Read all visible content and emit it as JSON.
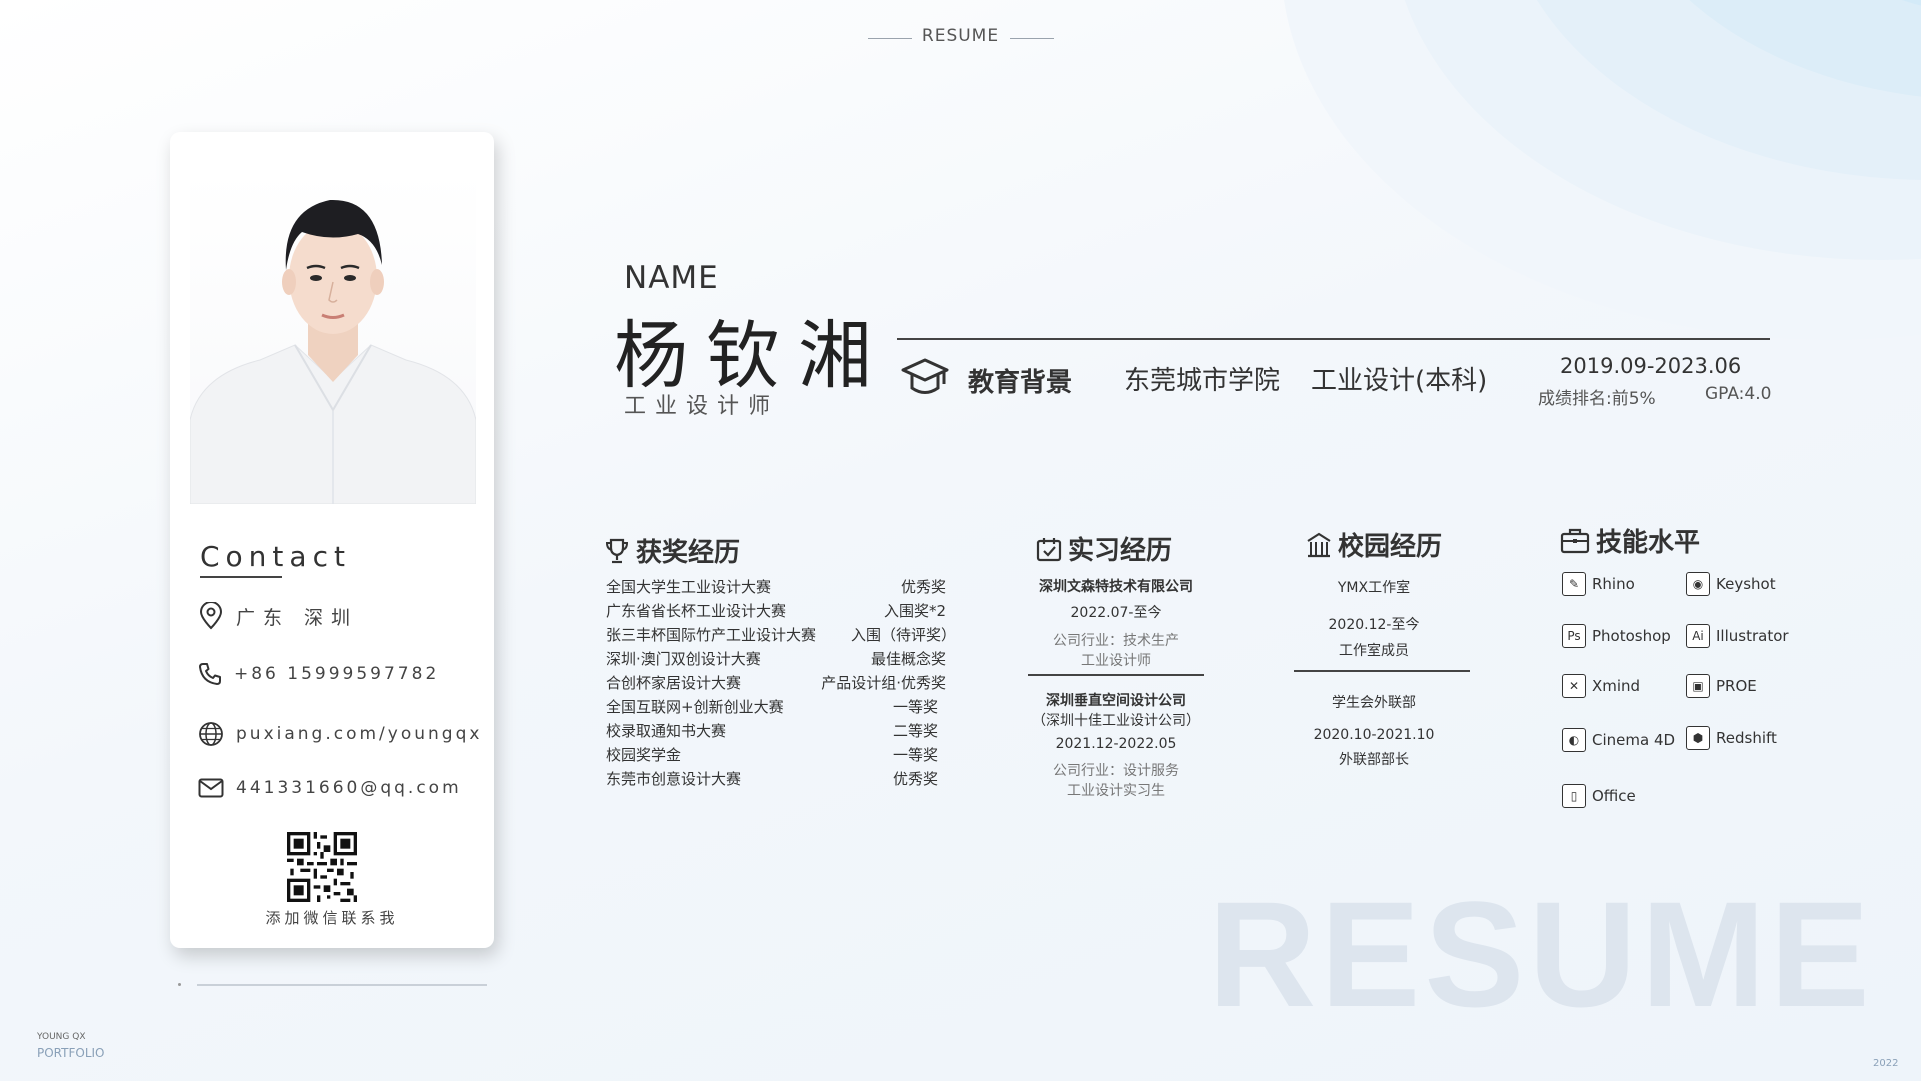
{
  "header": {
    "title": "RESUME"
  },
  "profile": {
    "name_label": "NAME",
    "name": "杨钦湘",
    "role": "工业设计师"
  },
  "contact": {
    "title": "Contact",
    "location": "广东 深圳",
    "phone": "+86 15999597782",
    "website": "puxiang.com/youngqx",
    "email": "441331660@qq.com",
    "qr_caption": "添加微信联系我"
  },
  "education": {
    "title": "教育背景",
    "school": "东莞城市学院",
    "major": "工业设计(本科)",
    "date": "2019.09-2023.06",
    "rank": "成绩排名:前5%",
    "gpa": "GPA:4.0"
  },
  "awards": {
    "title": "获奖经历",
    "items": [
      {
        "name": "全国大学生工业设计大赛",
        "result": "优秀奖"
      },
      {
        "name": "广东省省长杯工业设计大赛",
        "result": "入围奖*2"
      },
      {
        "name": "张三丰杯国际竹产工业设计大赛",
        "result": "入围（待评奖）"
      },
      {
        "name": "深圳·澳门双创设计大赛",
        "result": "最佳概念奖"
      },
      {
        "name": "合创杯家居设计大赛",
        "result": "产品设计组·优秀奖"
      },
      {
        "name": "全国互联网+创新创业大赛",
        "result": "一等奖"
      },
      {
        "name": "校录取通知书大赛",
        "result": "二等奖"
      },
      {
        "name": "校园奖学金",
        "result": "一等奖"
      },
      {
        "name": "东莞市创意设计大赛",
        "result": "优秀奖"
      }
    ]
  },
  "internship": {
    "title": "实习经历",
    "items": [
      {
        "company": "深圳文森特技术有限公司",
        "company2": "",
        "date": "2022.07-至今",
        "industry": "公司行业：技术生产",
        "position": "工业设计师"
      },
      {
        "company": "深圳垂直空间设计公司",
        "company2": "（深圳十佳工业设计公司）",
        "date": "2021.12-2022.05",
        "industry": "公司行业：设计服务",
        "position": "工业设计实习生"
      }
    ]
  },
  "campus": {
    "title": "校园经历",
    "items": [
      {
        "org": "YMX工作室",
        "date": "2020.12-至今",
        "role": "工作室成员"
      },
      {
        "org": "学生会外联部",
        "date": "2020.10-2021.10",
        "role": "外联部部长"
      }
    ]
  },
  "skills": {
    "title": "技能水平",
    "items": [
      {
        "name": "Rhino",
        "icon": "rhino-icon",
        "glyph": "✎"
      },
      {
        "name": "Keyshot",
        "icon": "keyshot-icon",
        "glyph": "◉"
      },
      {
        "name": "Photoshop",
        "icon": "photoshop-icon",
        "glyph": "Ps"
      },
      {
        "name": "Illustrator",
        "icon": "illustrator-icon",
        "glyph": "Ai"
      },
      {
        "name": "Xmind",
        "icon": "xmind-icon",
        "glyph": "✕"
      },
      {
        "name": "PROE",
        "icon": "proe-icon",
        "glyph": "▣"
      },
      {
        "name": "Cinema 4D",
        "icon": "cinema4d-icon",
        "glyph": "◐"
      },
      {
        "name": "Redshift",
        "icon": "redshift-icon",
        "glyph": "⬢"
      },
      {
        "name": "Office",
        "icon": "office-icon",
        "glyph": "▯"
      }
    ]
  },
  "watermark": "RESUME",
  "footer": {
    "brand": "YOUNG QX",
    "portfolio": "PORTFOLIO",
    "year": "2022"
  }
}
